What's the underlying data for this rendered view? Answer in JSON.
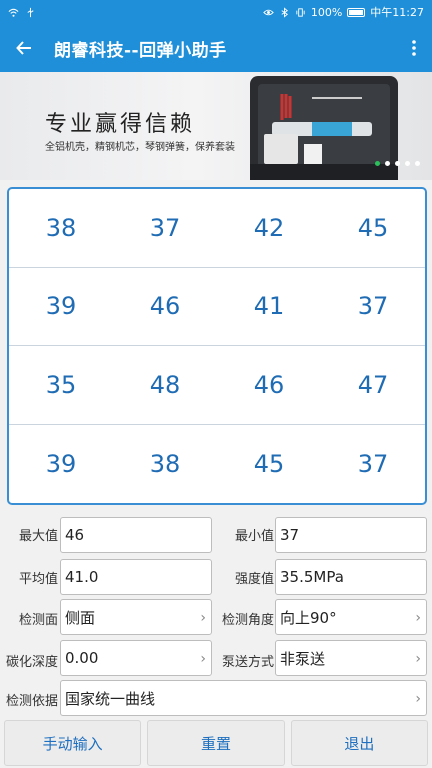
{
  "status_bar": {
    "battery": "100%",
    "clock": "中午11:27"
  },
  "app_bar": {
    "title": "朗睿科技--回弹小助手"
  },
  "banner": {
    "headline": "专业赢得信赖",
    "subline": "全铝机壳，精钢机芯，琴钢弹簧，保养套装",
    "slide_count": 5,
    "active_slide": 1
  },
  "readings": {
    "rows": [
      [
        "38",
        "37",
        "42",
        "45"
      ],
      [
        "39",
        "46",
        "41",
        "37"
      ],
      [
        "35",
        "48",
        "46",
        "47"
      ],
      [
        "39",
        "38",
        "45",
        "37"
      ]
    ]
  },
  "results": {
    "max_label": "最大值",
    "max_value": "46",
    "min_label": "最小值",
    "min_value": "37",
    "avg_label": "平均值",
    "avg_value": "41.0",
    "strength_label": "强度值",
    "strength_value": "35.5MPa",
    "surface_label": "检测面",
    "surface_value": "侧面",
    "angle_label": "检测角度",
    "angle_value": "向上90°",
    "carbon_label": "碳化深度",
    "carbon_value": "0.00",
    "pump_label": "泵送方式",
    "pump_value": "非泵送",
    "basis_label": "检测依据",
    "basis_value": "国家统一曲线"
  },
  "actions": {
    "manual_input": "手动输入",
    "reset": "重置",
    "exit": "退出"
  },
  "colors": {
    "primary": "#1e8fd8",
    "reading_text": "#1f6cb4",
    "grid_border": "#3a8fd4",
    "active_dot": "#2bc15a"
  }
}
